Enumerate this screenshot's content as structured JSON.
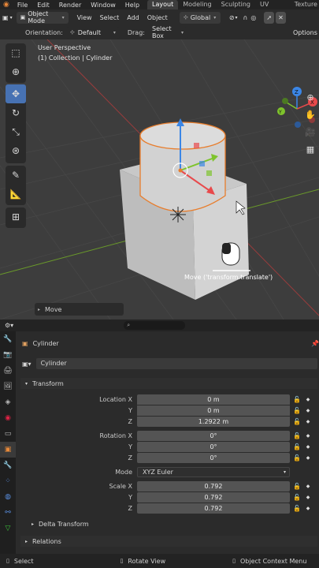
{
  "topbar": {
    "menus": [
      "File",
      "Edit",
      "Render",
      "Window",
      "Help"
    ],
    "workspaces": [
      "Layout",
      "Modeling",
      "Sculpting",
      "UV Editing",
      "Texture Pa"
    ],
    "active_workspace": "Layout"
  },
  "header": {
    "mode": "Object Mode",
    "view": "View",
    "select": "Select",
    "add": "Add",
    "object": "Object",
    "transform_orientation": "Global"
  },
  "subheader": {
    "orientation_label": "Orientation:",
    "orientation_value": "Default",
    "drag_label": "Drag:",
    "drag_value": "Select Box",
    "options": "Options"
  },
  "viewport": {
    "view_name": "User Perspective",
    "collection_info": "(1) Collection | Cylinder",
    "operator_tooltip": "Move ('transform.translate')",
    "last_operator": "Move",
    "gizmo_axes": [
      "X",
      "Y",
      "Z"
    ]
  },
  "properties": {
    "search_placeholder": "",
    "object_name_header": "Cylinder",
    "object_name_field": "Cylinder",
    "transform_panel": "Transform",
    "location_label": "Location X",
    "y_label": "Y",
    "z_label": "Z",
    "location": [
      "0 m",
      "0 m",
      "1.2922 m"
    ],
    "rotation_label": "Rotation X",
    "rotation": [
      "0°",
      "0°",
      "0°"
    ],
    "mode_label": "Mode",
    "mode_value": "XYZ Euler",
    "scale_label": "Scale X",
    "scale": [
      "0.792",
      "0.792",
      "0.792"
    ],
    "delta_transform": "Delta Transform",
    "relations": "Relations"
  },
  "statusbar": {
    "select": "Select",
    "rotate_view": "Rotate View",
    "context_menu": "Object Context Menu"
  },
  "colors": {
    "accent": "#4772b3",
    "x_axis": "#e8494b",
    "y_axis": "#7ec32c",
    "z_axis": "#3b86e6",
    "selection_outline": "#e87d2c"
  }
}
